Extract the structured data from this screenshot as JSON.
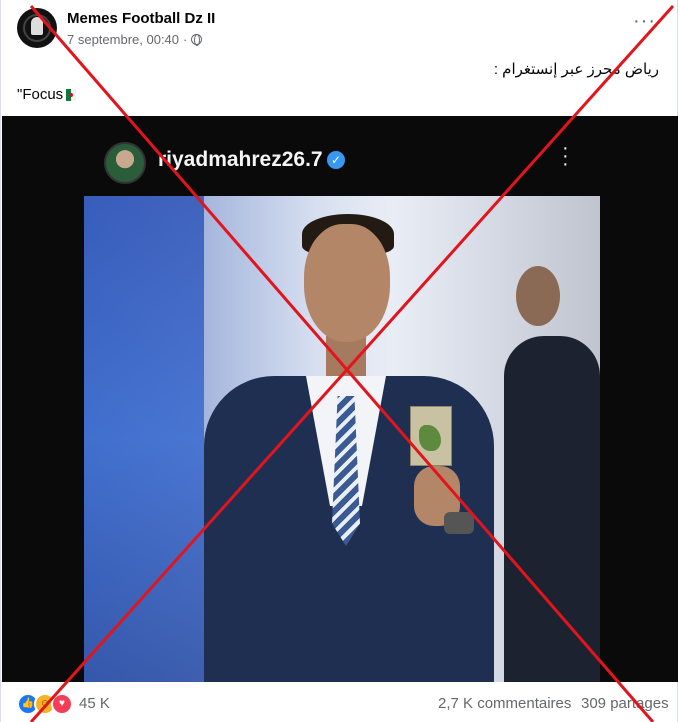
{
  "post": {
    "page_name": "Memes Football Dz II",
    "timestamp": "7 septembre, 00:40",
    "audience_icon": "globe-icon",
    "more_icon": "more-options-icon",
    "text_arabic": "رياض محرز عبر إنستغرام :",
    "text_focus": "\"Focus",
    "flag_icon": "algeria-flag-icon"
  },
  "media": {
    "instagram_username": "riyadmahrez26.7",
    "verified_icon": "verified-badge-icon",
    "more_icon": "vertical-dots-icon"
  },
  "overlay": {
    "cross_color": "#e2141c"
  },
  "footer": {
    "reactions_count": "45 K",
    "reaction_icons": [
      "like-icon",
      "haha-icon",
      "love-icon"
    ],
    "comments": "2,7 K commentaires",
    "shares": "309 partages"
  }
}
